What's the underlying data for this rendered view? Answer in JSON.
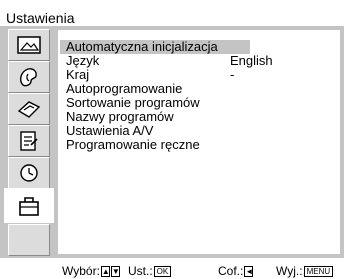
{
  "title": "Ustawienia",
  "sidebar": {
    "items": [
      {
        "icon": "picture-settings-icon"
      },
      {
        "icon": "sound-settings-icon"
      },
      {
        "icon": "screen-settings-icon"
      },
      {
        "icon": "features-icon"
      },
      {
        "icon": "timer-icon"
      },
      {
        "icon": "setup-toolbox-icon",
        "active": true
      },
      {
        "icon": "empty-slot"
      }
    ]
  },
  "menu": {
    "items": [
      {
        "label": "Automatyczna inicjalizacja",
        "value": "",
        "selected": true
      },
      {
        "label": "Język",
        "value": "English"
      },
      {
        "label": "Kraj",
        "value": "-"
      },
      {
        "label": "Autoprogramowanie",
        "value": ""
      },
      {
        "label": "Sortowanie programów",
        "value": ""
      },
      {
        "label": "Nazwy programów",
        "value": ""
      },
      {
        "label": "Ustawienia A/V",
        "value": ""
      },
      {
        "label": "Programowanie ręczne",
        "value": ""
      }
    ]
  },
  "footer": {
    "select_label": "Wybór:",
    "select_keys": [
      "▲",
      "▼"
    ],
    "set_label": "Ust.:",
    "set_key": "OK",
    "back_label": "Cof.:",
    "back_key": "◄",
    "exit_label": "Wyj.:",
    "exit_key": "MENU"
  }
}
